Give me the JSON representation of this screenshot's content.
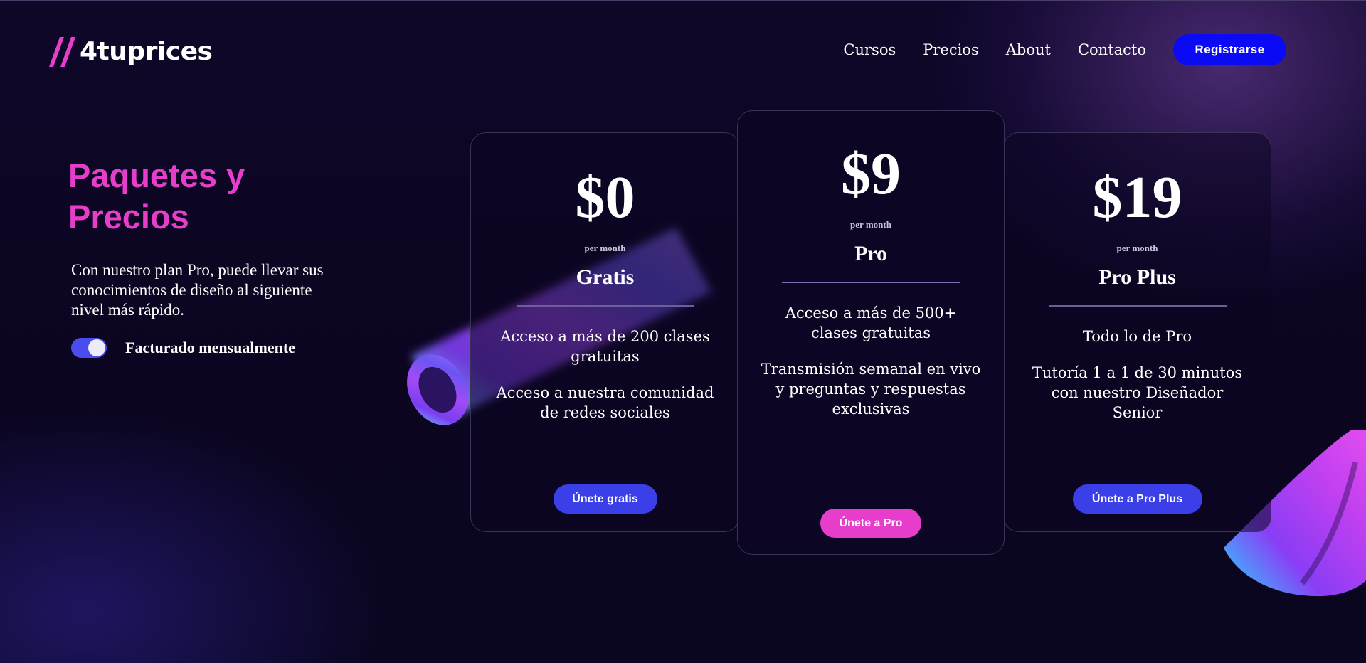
{
  "brand": {
    "name": "4tuprices",
    "accent": "#e63dcb"
  },
  "nav": {
    "links": [
      "Cursos",
      "Precios",
      "About",
      "Contacto"
    ],
    "cta": "Registrarse",
    "cta_color": "#0a0af5"
  },
  "hero": {
    "title": "Paquetes y Precios",
    "description": "Con nuestro plan Pro, puede llevar sus conocimientos de diseño al siguiente nivel más rápido.",
    "billing_toggle": {
      "label": "Facturado mensualmente",
      "on": true
    }
  },
  "plans": [
    {
      "price": "$0",
      "period": "per month",
      "name": "Gratis",
      "features": [
        "Acceso a más de 200 clases gratuitas",
        "Acceso a nuestra comunidad de redes sociales"
      ],
      "cta": "Únete gratis",
      "cta_color": "#3b3fe8"
    },
    {
      "price": "$9",
      "period": "per month",
      "name": "Pro",
      "features": [
        "Acceso a más de 500+ clases gratuitas",
        "Transmisión semanal en vivo y preguntas y respuestas exclusivas"
      ],
      "cta": "Únete a Pro",
      "cta_color": "#e63dcb"
    },
    {
      "price": "$19",
      "period": "per month",
      "name": "Pro Plus",
      "features": [
        "Todo lo de Pro",
        "Tutoría 1 a 1 de 30 minutos con nuestro Diseñador Senior"
      ],
      "cta": "Únete a Pro Plus",
      "cta_color": "#3b3fe8"
    }
  ]
}
